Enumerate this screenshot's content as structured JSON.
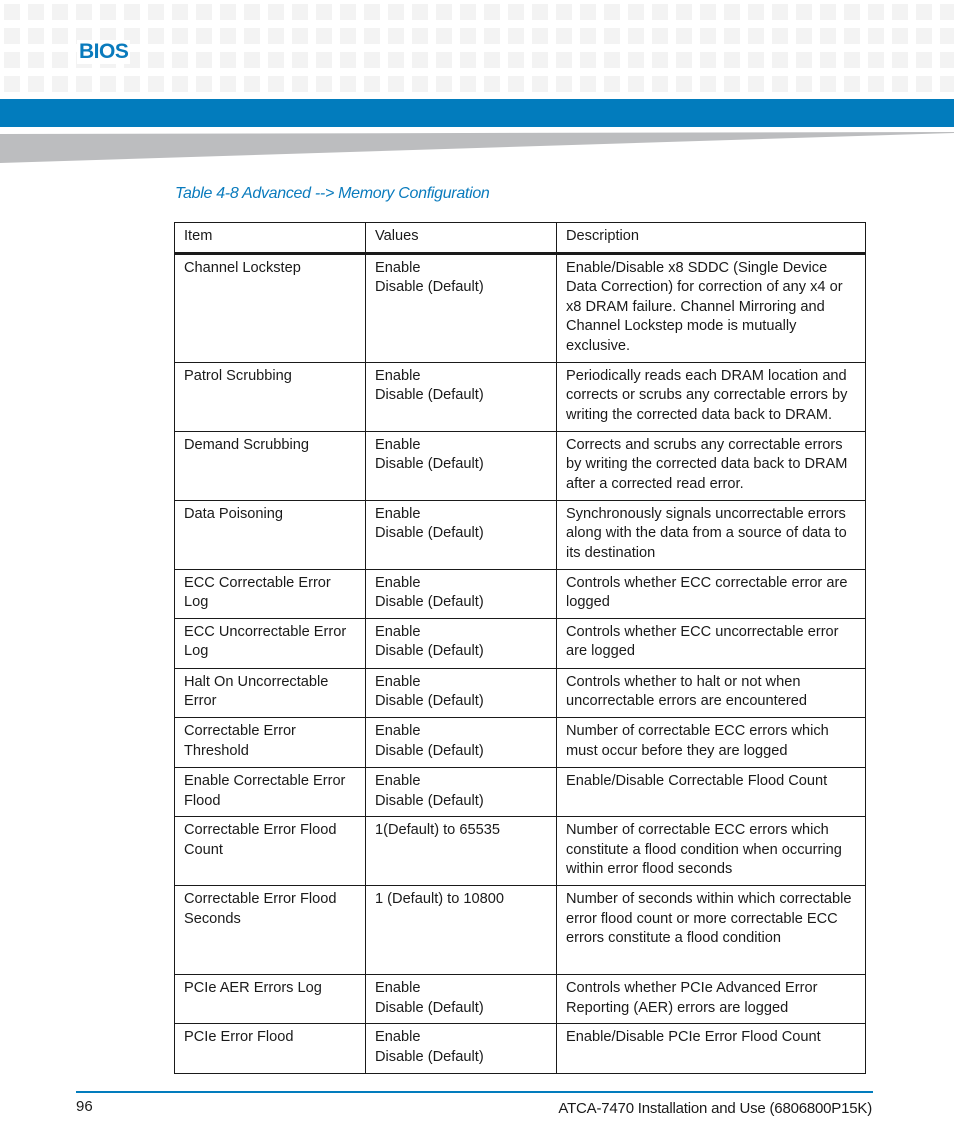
{
  "header": {
    "section_title": "BIOS",
    "accent_color": "#027cbd"
  },
  "table": {
    "caption": "Table 4-8 Advanced --> Memory Configuration",
    "columns": [
      "Item",
      "Values",
      "Description"
    ],
    "rows": [
      {
        "item": "Channel Lockstep",
        "values": [
          "Enable",
          "Disable (Default)"
        ],
        "description": "Enable/Disable x8 SDDC (Single Device Data Correction) for correction of any x4 or x8 DRAM failure. Channel Mirroring and Channel Lockstep mode is mutually exclusive."
      },
      {
        "item": "Patrol Scrubbing",
        "values": [
          "Enable",
          "Disable (Default)"
        ],
        "description": "Periodically reads each DRAM location and corrects or scrubs any correctable errors by writing the corrected data back to DRAM."
      },
      {
        "item": "Demand Scrubbing",
        "values": [
          "Enable",
          "Disable (Default)"
        ],
        "description": "Corrects and scrubs any correctable errors by writing the corrected data back to DRAM after a corrected read error."
      },
      {
        "item": "Data Poisoning",
        "values": [
          "Enable",
          "Disable (Default)"
        ],
        "description": " Synchronously signals uncorrectable errors along with the data from a source of data to its destination"
      },
      {
        "item": "ECC Correctable Error Log",
        "values": [
          "Enable",
          "Disable (Default)"
        ],
        "description": "Controls whether ECC correctable error are logged"
      },
      {
        "item": "ECC Uncorrectable Error Log",
        "values": [
          "Enable",
          "Disable (Default)"
        ],
        "description": "Controls whether ECC uncorrectable error are logged"
      },
      {
        "item": "Halt On Uncorrectable Error",
        "values": [
          "Enable",
          "Disable (Default)"
        ],
        "description": "Controls whether to halt or not when uncorrectable errors are encountered"
      },
      {
        "item": "Correctable Error Threshold",
        "values": [
          "Enable",
          "Disable (Default)"
        ],
        "description": "Number of correctable ECC errors which must occur before they are logged"
      },
      {
        "item": "Enable Correctable Error Flood",
        "values": [
          "Enable",
          "Disable (Default)"
        ],
        "description": "Enable/Disable Correctable Flood Count"
      },
      {
        "item": "Correctable Error Flood Count",
        "values": [
          "1(Default) to 65535"
        ],
        "description": "Number of correctable ECC errors which constitute a flood condition when occurring within error flood seconds"
      },
      {
        "item": "Correctable Error Flood Seconds",
        "values": [
          "1 (Default) to 10800"
        ],
        "description": "Number of seconds within which correctable error flood count or more correctable ECC errors constitute a flood condition"
      },
      {
        "item": "PCIe AER Errors Log",
        "values": [
          "Enable",
          "Disable (Default)"
        ],
        "description": "Controls whether PCIe Advanced Error Reporting (AER) errors are logged"
      },
      {
        "item": "PCIe Error Flood",
        "values": [
          "Enable",
          "Disable (Default)"
        ],
        "description": "Enable/Disable PCIe Error Flood Count"
      }
    ]
  },
  "footer": {
    "page_number": "96",
    "document_title": "ATCA-7470 Installation and Use (6806800P15K)"
  }
}
